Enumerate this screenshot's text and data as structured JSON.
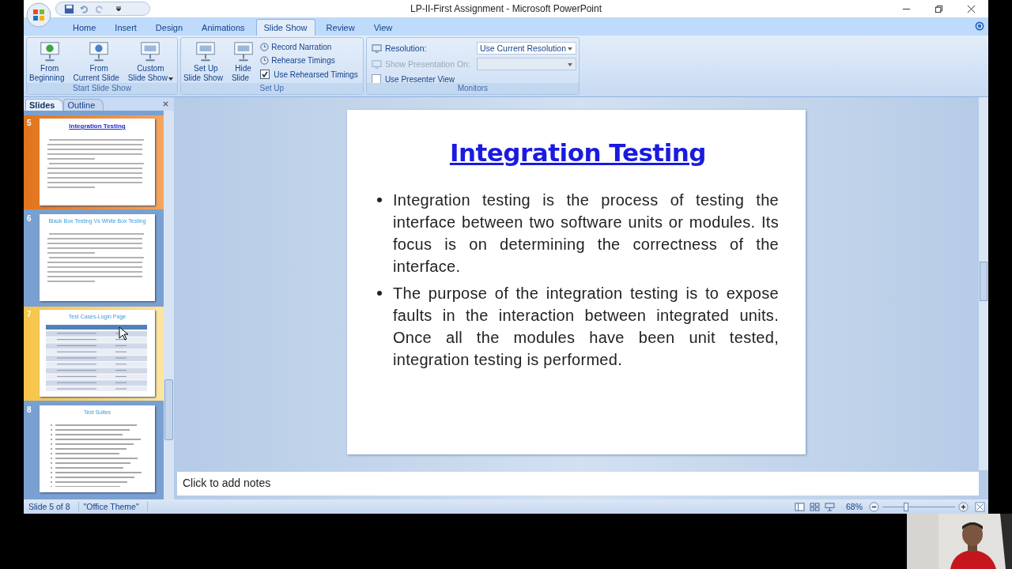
{
  "window": {
    "title": "LP-II-First Assignment - Microsoft PowerPoint"
  },
  "tabs": [
    {
      "label": "Home",
      "selected": false
    },
    {
      "label": "Insert",
      "selected": false
    },
    {
      "label": "Design",
      "selected": false
    },
    {
      "label": "Animations",
      "selected": false
    },
    {
      "label": "Slide Show",
      "selected": true
    },
    {
      "label": "Review",
      "selected": false
    },
    {
      "label": "View",
      "selected": false
    }
  ],
  "ribbon": {
    "groups": [
      {
        "title": "Start Slide Show",
        "buttons": [
          {
            "kind": "large",
            "label": "From\nBeginning",
            "dropdown": false
          },
          {
            "kind": "large",
            "label": "From\nCurrent Slide",
            "dropdown": false
          },
          {
            "kind": "large",
            "label": "Custom\nSlide Show",
            "dropdown": true
          }
        ]
      },
      {
        "title": "Set Up",
        "buttons": [
          {
            "kind": "large",
            "label": "Set Up\nSlide Show",
            "dropdown": false
          },
          {
            "kind": "large",
            "label": "Hide\nSlide",
            "dropdown": false
          },
          {
            "kind": "small",
            "label": "Record Narration"
          },
          {
            "kind": "small",
            "label": "Rehearse Timings"
          },
          {
            "kind": "checkbox",
            "label": "Use Rehearsed Timings",
            "checked": true
          }
        ]
      },
      {
        "title": "Monitors",
        "buttons": [
          {
            "kind": "dropdown",
            "label": "Resolution:",
            "value": "Use Current Resolution",
            "disabled": false
          },
          {
            "kind": "dropdown",
            "label": "Show Presentation On:",
            "disabled": true
          },
          {
            "kind": "checkbox",
            "label": "Use Presenter View",
            "checked": false
          }
        ]
      }
    ]
  },
  "pane": {
    "tabs": [
      {
        "label": "Slides",
        "selected": true
      },
      {
        "label": "Outline",
        "selected": false
      }
    ],
    "slides": [
      {
        "number": "5",
        "selected": true,
        "hovered": false,
        "kind": "bullets",
        "title_underlined": true,
        "title": "Integration Testing"
      },
      {
        "number": "6",
        "selected": false,
        "hovered": false,
        "kind": "bullets",
        "title_underlined": false,
        "title": "Black Box Testing Vs White Box Testing"
      },
      {
        "number": "7",
        "selected": false,
        "hovered": true,
        "kind": "table",
        "title_underlined": false,
        "title": "Test Cases-Login Page"
      },
      {
        "number": "8",
        "selected": false,
        "hovered": false,
        "kind": "list",
        "title_underlined": false,
        "title": "Test Suites"
      }
    ]
  },
  "slide": {
    "title": "Integration Testing",
    "bullets": [
      "Integration testing is the process of testing the interface between two software units or modules. Its focus is on determining the correctness of the interface.",
      "The purpose of the integration testing is to expose faults in the interaction between integrated units. Once all the modules have been unit tested, integration testing is performed."
    ]
  },
  "notes": {
    "placeholder": "Click to add notes"
  },
  "status_bar": {
    "slide": "Slide 5 of 8",
    "theme": "\"Office Theme\"",
    "zoom": "68%",
    "zoom_slider": {
      "level": 0.33
    }
  }
}
